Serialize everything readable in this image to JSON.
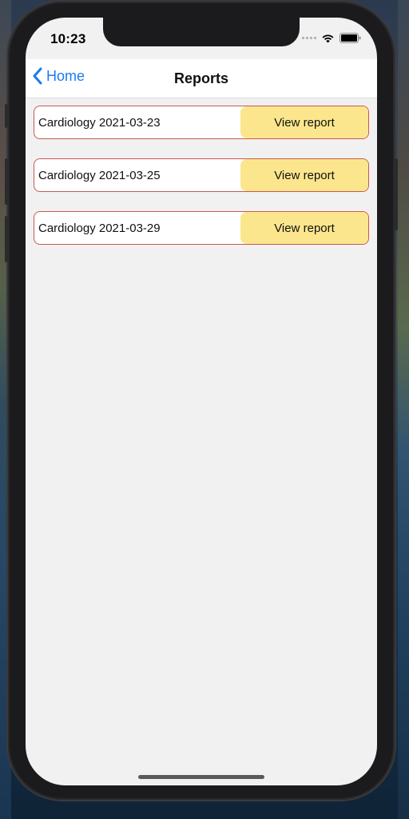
{
  "status_bar": {
    "time": "10:23"
  },
  "nav": {
    "back_label": "Home",
    "title": "Reports"
  },
  "reports": [
    {
      "name": "Cardiology 2021-03-23",
      "button_label": "View report"
    },
    {
      "name": "Cardiology 2021-03-25",
      "button_label": "View report"
    },
    {
      "name": "Cardiology 2021-03-29",
      "button_label": "View report"
    }
  ],
  "colors": {
    "accent_blue": "#1a7cf0",
    "button_yellow": "#fce68d",
    "row_border": "#c8594f",
    "screen_bg": "#f1f1f1"
  },
  "icons": {
    "back": "chevron-left-icon",
    "wifi": "wifi-icon",
    "battery": "battery-icon",
    "signal": "cellular-signal-icon"
  }
}
